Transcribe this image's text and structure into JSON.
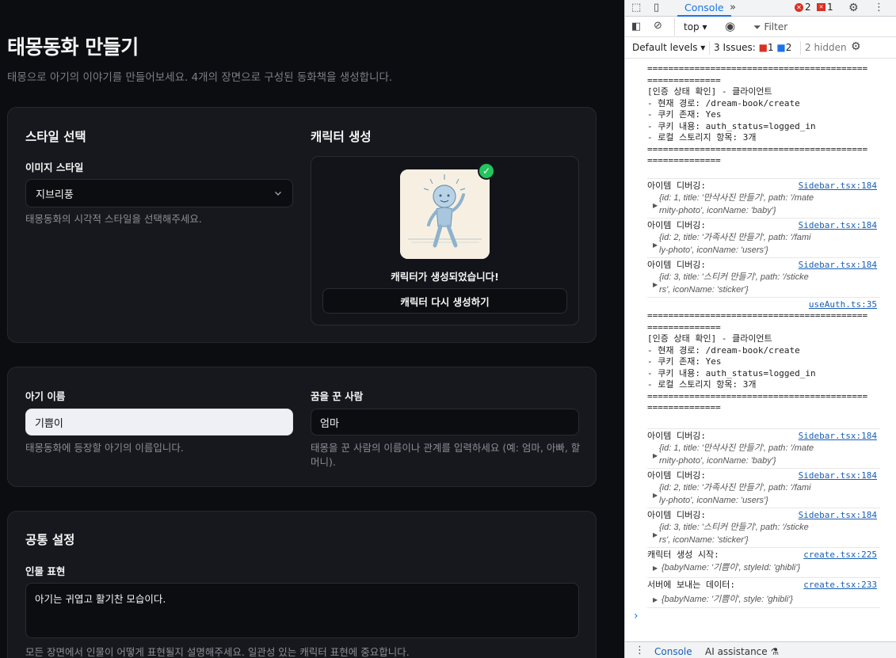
{
  "page": {
    "title": "태몽동화 만들기",
    "subtitle": "태몽으로 아기의 이야기를 만들어보세요. 4개의 장면으로 구성된 동화책을 생성합니다."
  },
  "style_section": {
    "heading": "스타일 선택",
    "field_label": "이미지 스타일",
    "selected": "지브리풍",
    "help": "태몽동화의 시각적 스타일을 선택해주세요."
  },
  "character_section": {
    "heading": "캐릭터 생성",
    "status": "캐릭터가 생성되었습니다!",
    "regen_button": "캐릭터 다시 생성하기"
  },
  "names_section": {
    "baby_label": "아기 이름",
    "baby_value": "기쁨이",
    "baby_help": "태몽동화에 등장할 아기의 이름입니다.",
    "dreamer_label": "꿈을 꾼 사람",
    "dreamer_value": "엄마",
    "dreamer_help_1": "태몽을 꾼 사람의 이름이나 관계를 입력하세요 (예: 엄마, 아빠, 할",
    "dreamer_help_2": "머니)."
  },
  "common_section": {
    "heading": "공통 설정",
    "field_label": "인물 표현",
    "value": "아기는 귀엽고 활기찬 모습이다.",
    "help": "모든 장면에서 인물이 어떻게 표현될지 설명해주세요. 일관성 있는 캐릭터 표현에 중요합니다."
  },
  "devtools": {
    "tab": "Console",
    "errors": "2",
    "warnings": "1",
    "context": "top",
    "filter_placeholder": "Filter",
    "levels": "Default levels",
    "issues_label": "3 Issues:",
    "issues_errors": "1",
    "issues_info": "2",
    "hidden": "2 hidden",
    "prompt": "›",
    "bottom_console": "Console",
    "bottom_ai": "AI assistance",
    "sep_line_1": "==========================================",
    "sep_line_2": "==============",
    "auth": {
      "l1": "[인증 상태 확인] - 클라이언트",
      "l2": "- 현재 경로: /dream-book/create",
      "l3": "- 쿠키 존재: Yes",
      "l4": "- 쿠키 내용: auth_status=logged_in",
      "l5": "- 로컬 스토리지 항목: 3개"
    },
    "item_label": "아이템 디버깅:",
    "sidebar_src": "Sidebar.tsx:184",
    "useauth_src": "useAuth.ts:35",
    "items": [
      {
        "a": "{id: 1, title: '만삭사진 만들기', path: '/mate",
        "b": "rnity-photo', iconName: 'baby'}"
      },
      {
        "a": "{id: 2, title: '가족사진 만들기', path: '/fami",
        "b": "ly-photo', iconName: 'users'}"
      },
      {
        "a": "{id: 3, title: '스티커 만들기', path: '/sticke",
        "b": "rs', iconName: 'sticker'}"
      }
    ],
    "create_start": "캐릭터 생성 시작:",
    "create_start_src": "create.tsx:225",
    "create_start_obj": "{babyName: '기쁨이', styleId: 'ghibli'}",
    "server_data": "서버에 보내는 데이터:",
    "server_data_src": "create.tsx:233",
    "server_data_obj": "{babyName: '기쁨이', style: 'ghibli'}"
  }
}
